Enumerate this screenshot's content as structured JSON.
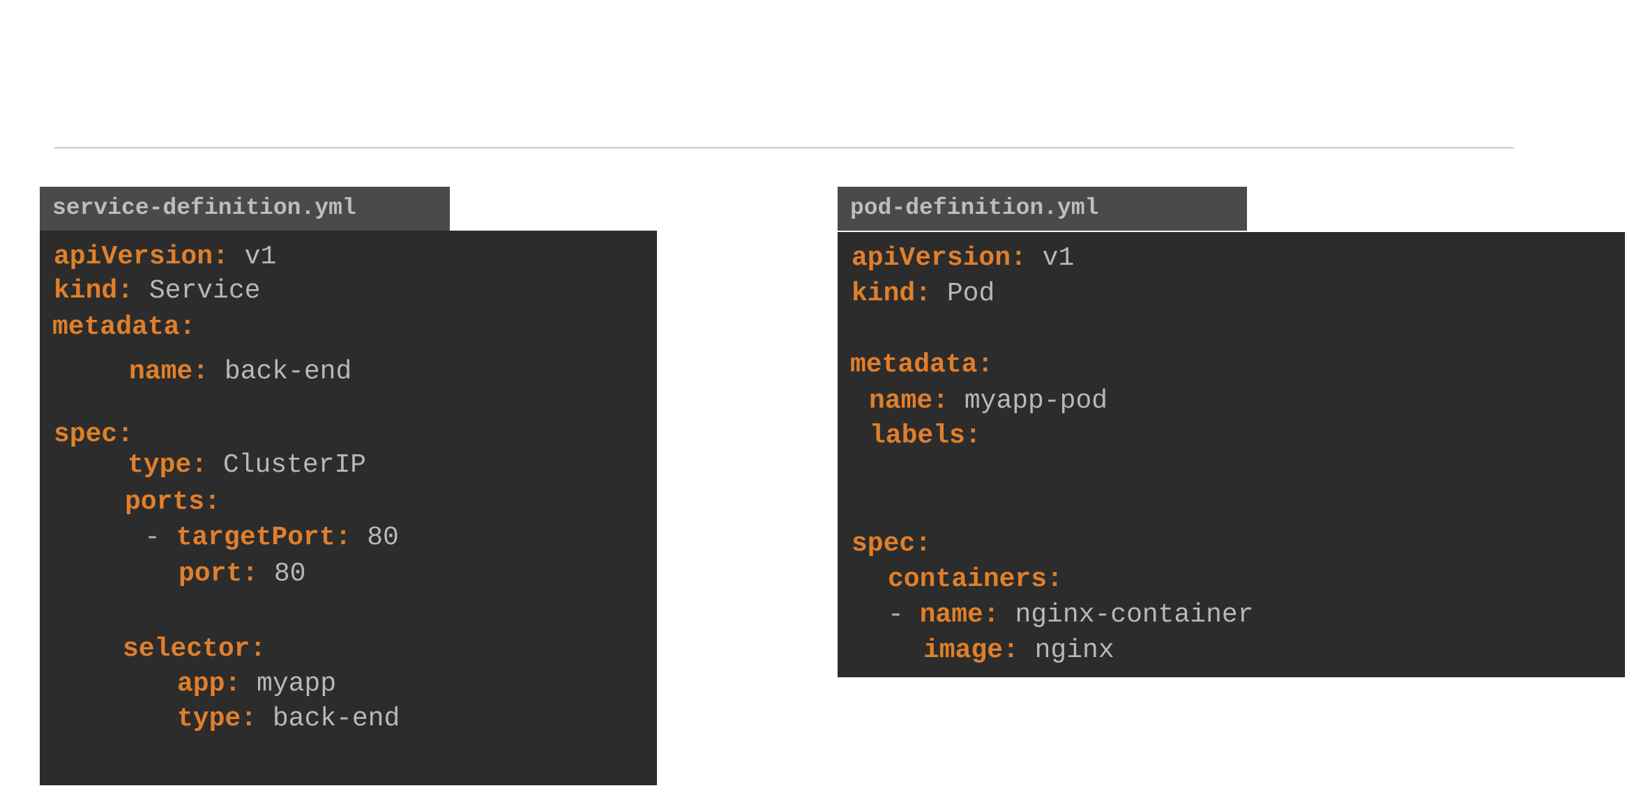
{
  "left_file": {
    "title": "service-definition.yml",
    "lines": [
      {
        "key": "apiVersion:",
        "value": " v1"
      },
      {
        "key": "kind:",
        "value": " Service"
      },
      {
        "key": "metadata:",
        "value": ""
      },
      {
        "key": "name:",
        "value": " back-end"
      },
      {
        "key": "spec:",
        "value": ""
      },
      {
        "key": "type:",
        "value": " ClusterIP"
      },
      {
        "key": "ports:",
        "value": ""
      },
      {
        "dash": "- ",
        "key": "targetPort:",
        "value": " 80"
      },
      {
        "key": "port:",
        "value": " 80"
      },
      {
        "key": "selector:",
        "value": ""
      },
      {
        "key": "app:",
        "value": " myapp"
      },
      {
        "key": "type:",
        "value": " back-end"
      }
    ]
  },
  "right_file": {
    "title": "pod-definition.yml",
    "lines": [
      {
        "key": "apiVersion:",
        "value": " v1"
      },
      {
        "key": "kind:",
        "value": " Pod"
      },
      {
        "key": "metadata:",
        "value": ""
      },
      {
        "key": "name:",
        "value": " myapp-pod"
      },
      {
        "key": "labels:",
        "value": ""
      },
      {
        "key": "spec:",
        "value": ""
      },
      {
        "key": "containers:",
        "value": ""
      },
      {
        "dash": "- ",
        "key": "name:",
        "value": " nginx-container"
      },
      {
        "key": "image:",
        "value": " nginx"
      }
    ]
  },
  "colors": {
    "key": "#e07f2b",
    "value": "#b8b8b8",
    "panel": "#2c2c2c",
    "tab": "#4a4a4a"
  }
}
